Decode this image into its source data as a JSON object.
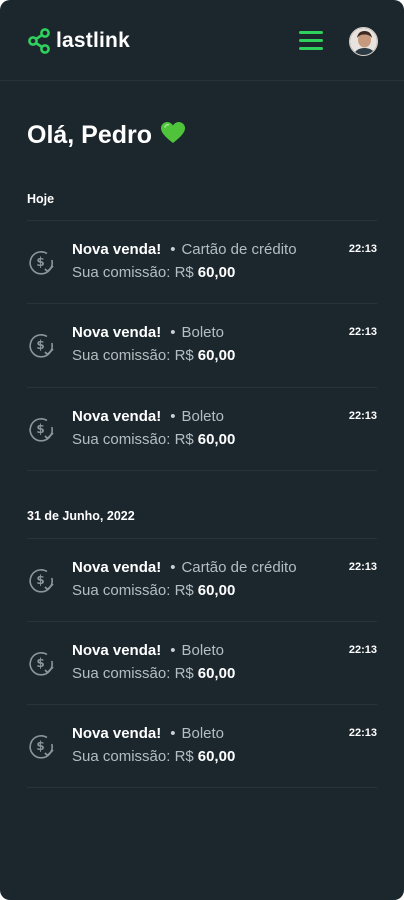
{
  "brand": {
    "name": "lastlink",
    "accent": "#2fd05b",
    "background": "#1b262d"
  },
  "header": {
    "menu_icon": "hamburger-menu-icon",
    "avatar_icon": "user-avatar"
  },
  "greeting": {
    "text": "Olá, Pedro",
    "emoji": "💚"
  },
  "sections": [
    {
      "label": "Hoje",
      "items": [
        {
          "title": "Nova venda!",
          "separator": "•",
          "method": "Cartão de crédito",
          "commission_label": "Sua comissão:",
          "currency": "R$",
          "amount": "60,00",
          "time": "22:13"
        },
        {
          "title": "Nova venda!",
          "separator": "•",
          "method": "Boleto",
          "commission_label": "Sua comissão:",
          "currency": "R$",
          "amount": "60,00",
          "time": "22:13"
        },
        {
          "title": "Nova venda!",
          "separator": "•",
          "method": "Boleto",
          "commission_label": "Sua comissão:",
          "currency": "R$",
          "amount": "60,00",
          "time": "22:13"
        }
      ]
    },
    {
      "label": "31 de Junho, 2022",
      "items": [
        {
          "title": "Nova venda!",
          "separator": "•",
          "method": "Cartão de crédito",
          "commission_label": "Sua comissão:",
          "currency": "R$",
          "amount": "60,00",
          "time": "22:13"
        },
        {
          "title": "Nova venda!",
          "separator": "•",
          "method": "Boleto",
          "commission_label": "Sua comissão:",
          "currency": "R$",
          "amount": "60,00",
          "time": "22:13"
        },
        {
          "title": "Nova venda!",
          "separator": "•",
          "method": "Boleto",
          "commission_label": "Sua comissão:",
          "currency": "R$",
          "amount": "60,00",
          "time": "22:13"
        }
      ]
    }
  ]
}
